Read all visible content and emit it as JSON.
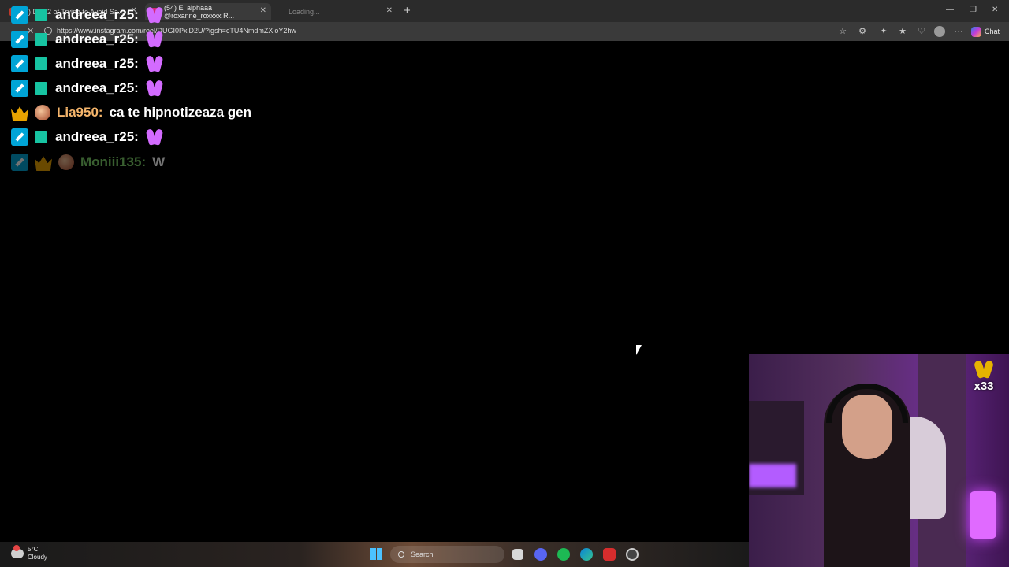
{
  "browser": {
    "tabs": [
      {
        "label": "(3) Day 2 of Trying to Avoid Sa..."
      },
      {
        "label": "(54) El alphaaa @roxanne_roxxxx R..."
      },
      {
        "label": "Loading..."
      }
    ],
    "new_tab": "+",
    "url": "https://www.instagram.com/reel/DUGI0PxiD2U/?igsh=cTU4NmdmZXloY2hw",
    "chat_label": "Chat"
  },
  "chat": {
    "messages": [
      {
        "user": "andreea_r25:",
        "text": "",
        "user_color": "#ffffff"
      },
      {
        "user": "andreea_r25:",
        "text": "",
        "user_color": "#ffffff"
      },
      {
        "user": "andreea_r25:",
        "text": "",
        "user_color": "#ffffff"
      },
      {
        "user": "andreea_r25:",
        "text": "",
        "user_color": "#ffffff"
      },
      {
        "user": "Lia950:",
        "text": "ca te hipnotizeaza gen",
        "user_color": "#f5b56b"
      },
      {
        "user": "andreea_r25:",
        "text": "",
        "user_color": "#ffffff"
      },
      {
        "user": "Moniii135:",
        "text": "W",
        "user_color": "#7fd36a"
      }
    ]
  },
  "overlay": {
    "sub_count": "x33"
  },
  "taskbar": {
    "weather_temp": "5°C",
    "weather_desc": "Cloudy",
    "search_label": "Search"
  },
  "colors": {
    "mod_badge": "#00a4d6",
    "sub_badge": "#17c4a2",
    "emote": "#d36bff"
  }
}
